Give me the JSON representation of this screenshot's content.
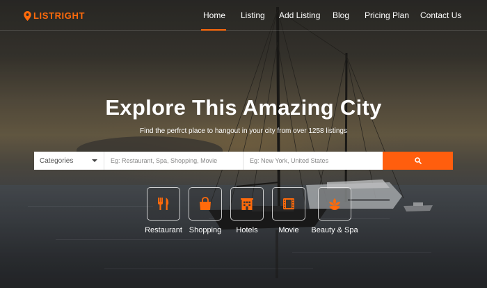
{
  "brand": {
    "name": "LISTRIGHT",
    "accent": "#ff6a0b"
  },
  "nav": {
    "items": [
      {
        "label": "Home",
        "active": true
      },
      {
        "label": "Listing"
      },
      {
        "label": "Add Listing"
      },
      {
        "label": "Blog"
      },
      {
        "label": "Pricing Plan"
      },
      {
        "label": "Contact Us"
      }
    ]
  },
  "hero": {
    "title": "Explore This Amazing City",
    "subtitle": "Find the perfrct place to hangout in your city from over 1258 listings"
  },
  "search": {
    "category_value": "Categories",
    "what_placeholder": "Eg: Restaurant, Spa, Shopping, Movie",
    "where_placeholder": "Eg: New York, United States",
    "button_icon": "search-icon",
    "button_color": "#ff5e0e"
  },
  "categories": [
    {
      "label": "Restaurant",
      "icon": "fork-knife-icon"
    },
    {
      "label": "Shopping",
      "icon": "shopping-bag-icon"
    },
    {
      "label": "Hotels",
      "icon": "hotel-building-icon"
    },
    {
      "label": "Movie",
      "icon": "film-icon"
    },
    {
      "label": "Beauty & Spa",
      "icon": "lotus-icon"
    }
  ]
}
